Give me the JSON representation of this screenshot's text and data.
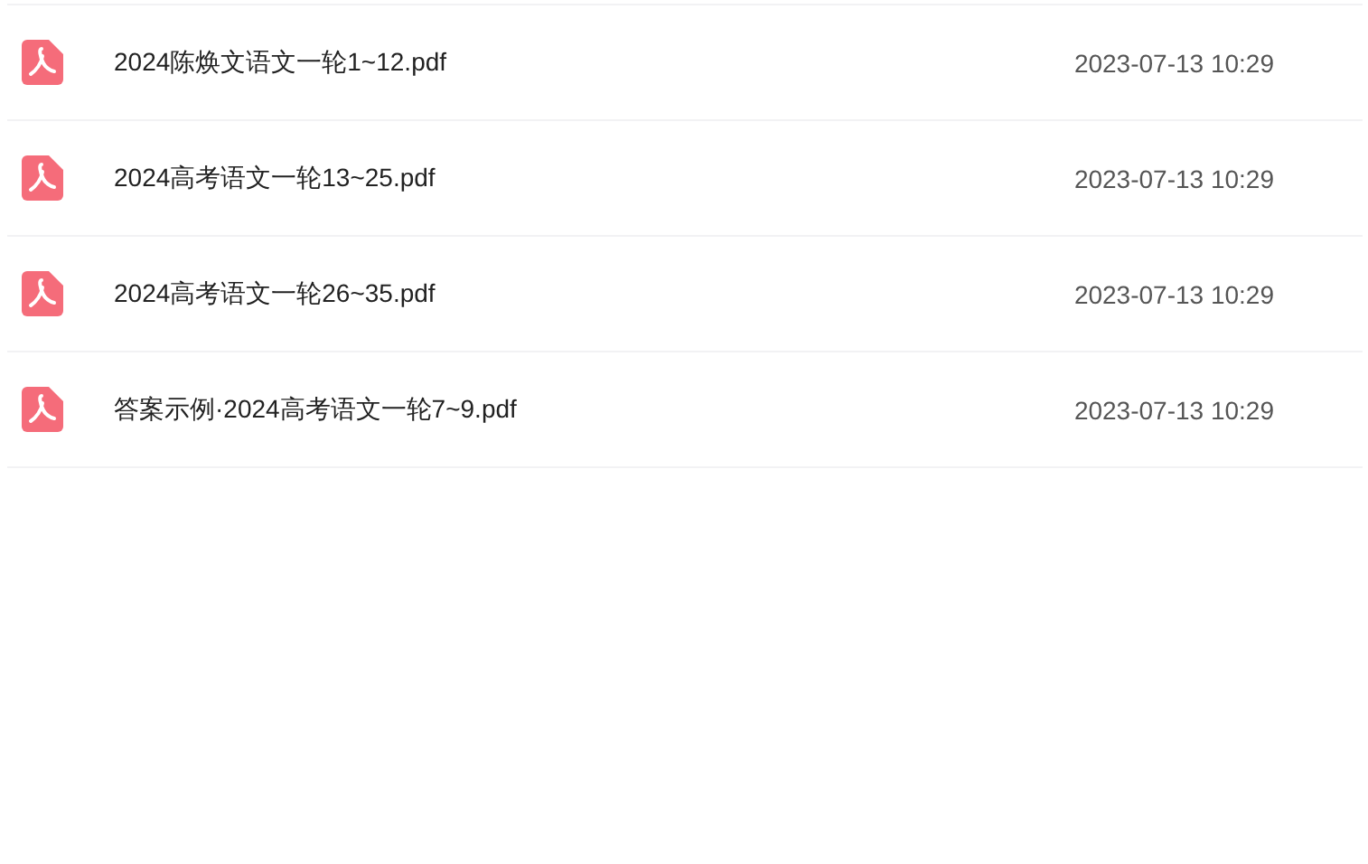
{
  "files": [
    {
      "name": "2024陈焕文语文一轮1~12.pdf",
      "kind": "pdf",
      "date": "2023-07-13 10:29"
    },
    {
      "name": "2024高考语文一轮13~25.pdf",
      "kind": "pdf",
      "date": "2023-07-13 10:29"
    },
    {
      "name": "2024高考语文一轮26~35.pdf",
      "kind": "pdf",
      "date": "2023-07-13 10:29"
    },
    {
      "name": "答案示例·2024高考语文一轮7~9.pdf",
      "kind": "pdf",
      "date": "2023-07-13 10:29"
    }
  ]
}
